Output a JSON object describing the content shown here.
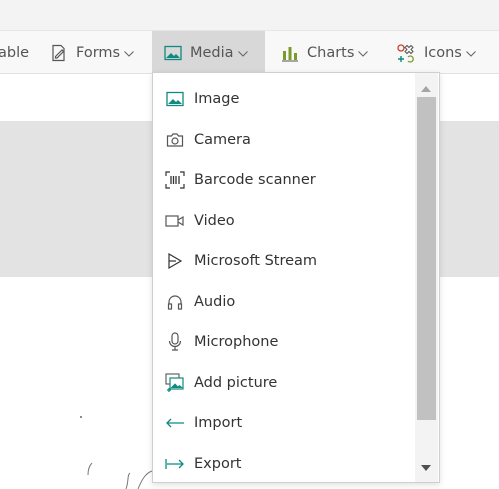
{
  "ribbon": {
    "items": [
      {
        "label": "able",
        "icon": "table-icon"
      },
      {
        "label": "Forms",
        "icon": "forms-icon"
      },
      {
        "label": "Media",
        "icon": "image-icon",
        "active": true
      },
      {
        "label": "Charts",
        "icon": "bar-chart-icon"
      },
      {
        "label": "Icons",
        "icon": "shapes-icon"
      }
    ]
  },
  "media_menu": {
    "items": [
      {
        "label": "Image",
        "icon": "image-icon"
      },
      {
        "label": "Camera",
        "icon": "camera-icon"
      },
      {
        "label": "Barcode scanner",
        "icon": "barcode-icon"
      },
      {
        "label": "Video",
        "icon": "video-icon"
      },
      {
        "label": "Microsoft Stream",
        "icon": "stream-icon"
      },
      {
        "label": "Audio",
        "icon": "headphones-icon"
      },
      {
        "label": "Microphone",
        "icon": "microphone-icon"
      },
      {
        "label": "Add picture",
        "icon": "add-picture-icon"
      },
      {
        "label": "Import",
        "icon": "import-icon"
      },
      {
        "label": "Export",
        "icon": "export-icon"
      }
    ]
  },
  "colors": {
    "accent_teal": "#0f8a80",
    "icon_gray": "#555555",
    "chart_green": "#7a9a2a"
  }
}
